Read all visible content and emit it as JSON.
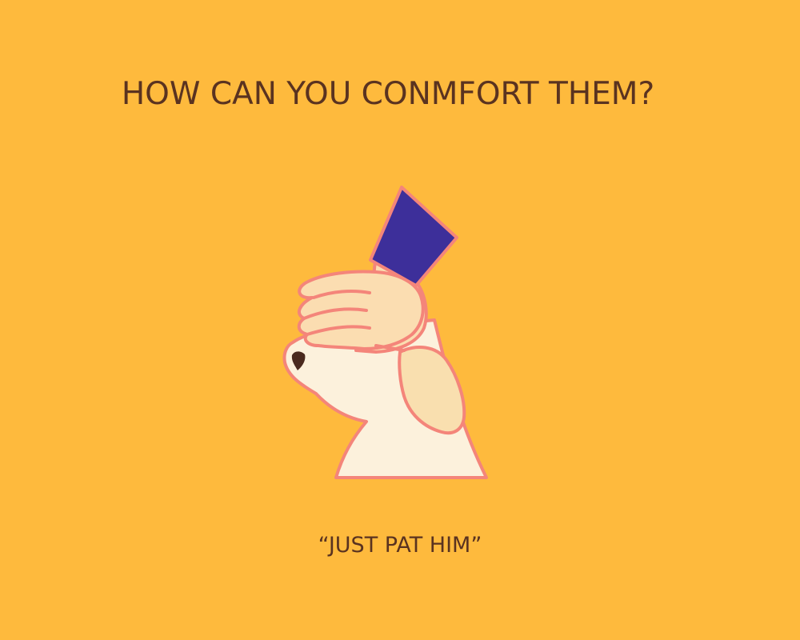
{
  "slide": {
    "title": "HOW CAN YOU CONMFORT THEM?",
    "caption": "“JUST PAT HIM”"
  },
  "illustration": {
    "subject": "dog-being-patted",
    "background_color": "#FEBA3D",
    "text_color": "#5A3320",
    "outline_color": "#F4857A",
    "sleeve_color": "#3D2F9A",
    "hand_color": "#FBDDB1",
    "dog_body_color": "#FCF1DC",
    "dog_ear_color": "#F9DFAF",
    "nose_color": "#4A2A1E"
  }
}
